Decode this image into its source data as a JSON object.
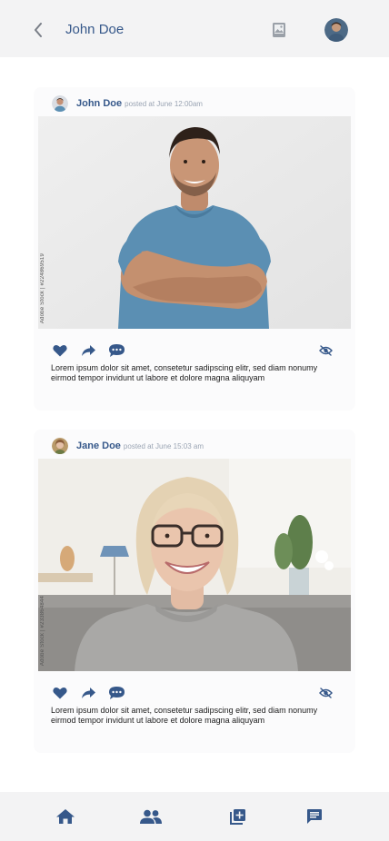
{
  "header": {
    "title": "John Doe",
    "back_icon": "chevron-left-icon",
    "gallery_icon": "image-gallery-icon"
  },
  "posts": [
    {
      "author": "John Doe",
      "time": "posted at June 12:00am",
      "watermark": "Adobe Stock | #224869519",
      "text": "Lorem ipsum dolor sit amet, consetetur sadipscing elitr, sed diam nonumy eirmod tempor invidunt ut labore et dolore magna aliquyam"
    },
    {
      "author": "Jane Doe",
      "time": "posted at June 15:03 am",
      "watermark": "Adobe Stock | #233864844",
      "text": "Lorem ipsum dolor sit amet, consetetur sadipscing elitr, sed diam nonumy eirmod tempor invidunt ut labore et dolore magna aliquyam"
    }
  ],
  "actions": [
    "heart-icon",
    "share-icon",
    "comment-icon",
    "hide-icon"
  ],
  "nav": [
    "home-icon",
    "people-icon",
    "add-post-icon",
    "messages-icon"
  ],
  "colors": {
    "accent": "#36588a",
    "header_bg": "#f3f3f4",
    "card_bg": "#fbfbfc"
  }
}
